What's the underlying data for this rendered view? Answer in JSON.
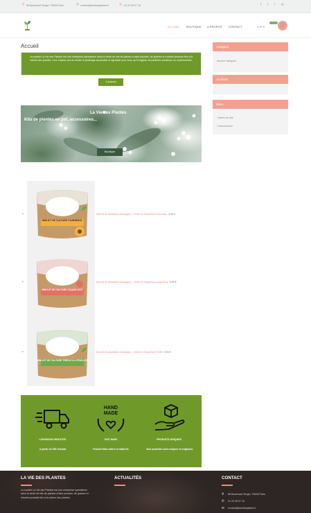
{
  "topbar": {
    "address": "36 Boulevard Sergei, 75006 Paris",
    "email": "contact@lavieduplantes.fr",
    "phone": "01 23 28 07 10",
    "social": [
      "f",
      "t",
      "i",
      "in"
    ]
  },
  "nav": {
    "items": [
      "ACCUEIL",
      "BOUTIQUE",
      "A PROPOS",
      "CONTACT"
    ],
    "active_index": 0,
    "cart_price": "0,00 €"
  },
  "main": {
    "title": "Accueil",
    "intro_text": "La société La Vie des Plantes est une entreprise spécialisée dans la vente de kits de plantes à faire pousser, de graines et d'autres produits liés à la culture des plantes. Leur mission est de rendre le jardinage accessible et agréable pour tous, qu'il s'agisse de jardiniers amateurs ou expérimentés.",
    "about_button": "A propos",
    "hero": {
      "title": "La Vie des Plantes",
      "subtitle": "Kits de plantes en pot, accessoires...",
      "button": "Boutique"
    },
    "products": [
      {
        "name": "Mini kit de plantation biologique – Herbe et Expansion Tournesol",
        "price": "9,90 €",
        "label": "MINI KIT DE CULTURE TOURNESOL",
        "accent": "#f2b33d"
      },
      {
        "name": "Mini kit de plantation biologique – Herbe et Expansion Coquelicot",
        "price": "9,90 €",
        "label": "MINI KIT DE CULTURE COQUELICOT",
        "accent": "#e86d66"
      },
      {
        "name": "Mini kit de plantation biologique – Herbe et Expansion Trèfle",
        "price": "9,90 €",
        "label": "MINI KIT DE CULTURE TRÈFLE À 4 FEUILLES",
        "accent": "#5fae4a"
      }
    ],
    "features": [
      {
        "icon": "truck-icon",
        "title": "LIVRAISON GRATUITE",
        "text": "A partir de 50€ d'achat"
      },
      {
        "icon": "handmade-icon",
        "title": "FAIT MAIN",
        "text": "Produit faits mains et naturels"
      },
      {
        "icon": "box-hand-icon",
        "title": "PRODUITS UNIQUES",
        "text": "Nos produits sont uniques et originaux"
      }
    ]
  },
  "sidebar": {
    "category": {
      "title": "Category",
      "line": "Aucune catégorie"
    },
    "archives": {
      "title": "Archives"
    },
    "meta": {
      "title": "Meta",
      "links": [
        "Admin du site",
        "Déconnexion"
      ]
    }
  },
  "footer": {
    "about_title": "LA VIE DES PLANTES",
    "about_text": "La société La Vie des Plantes est une entreprise spécialisée dans la vente de kits de plantes à faire pousser, de graines et d'autres produits liés à la culture des plantes.",
    "news_title": "ACTUALITÉS",
    "contact_title": "CONTACT",
    "contact_address": "68 Boulevard Sergei, 75006 Paris",
    "contact_phone": "01 23 28 07 10",
    "contact_email": "contact@lavedesplants.fr"
  },
  "colors": {
    "accent": "#f28b82",
    "green": "#6f9a2a",
    "widget_head": "#f4a090",
    "footer_bg": "#2d2624"
  }
}
